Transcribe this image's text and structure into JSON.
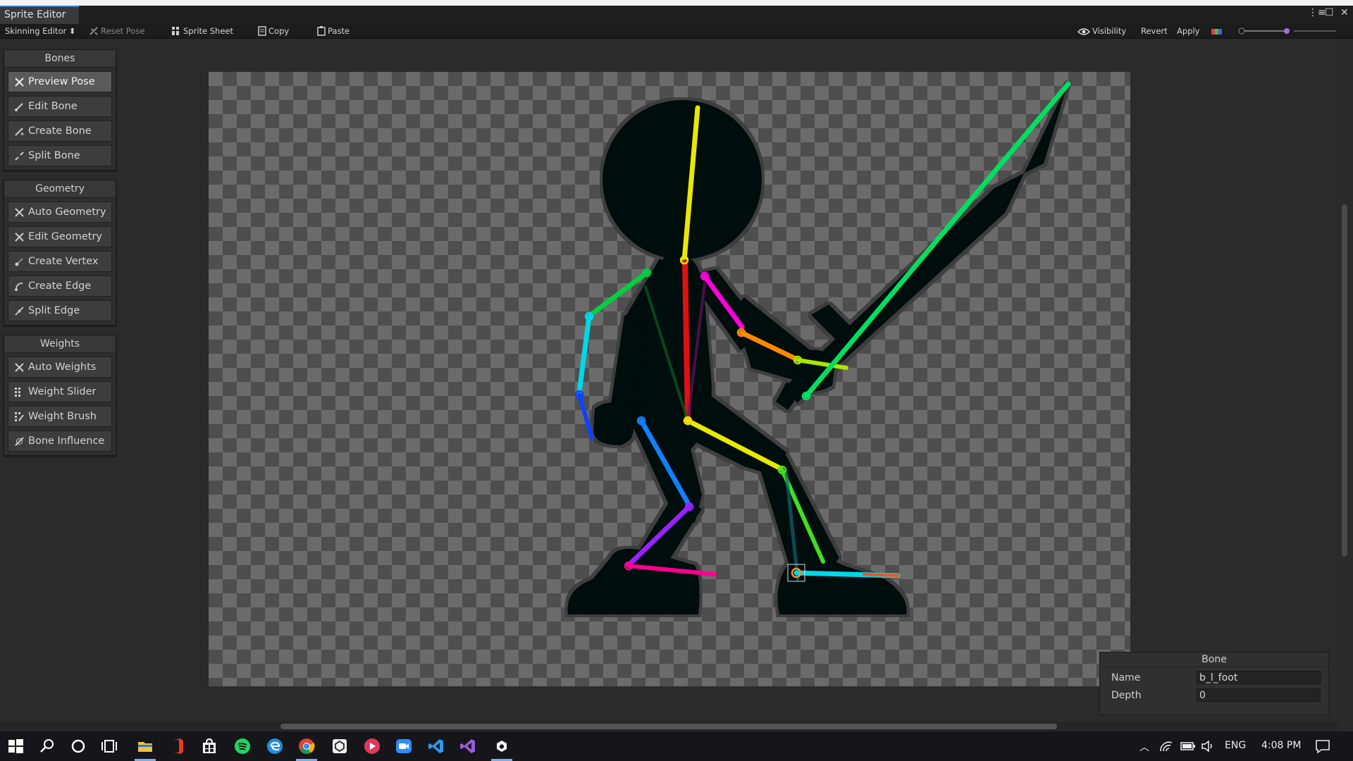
{
  "window": {
    "tab_title": "Sprite Editor"
  },
  "toolbar": {
    "mode_dropdown": "Skinning Editor",
    "reset_pose": "Reset Pose",
    "sprite_sheet": "Sprite Sheet",
    "copy": "Copy",
    "paste": "Paste",
    "visibility": "Visibility",
    "revert": "Revert",
    "apply": "Apply"
  },
  "panels": {
    "bones": {
      "title": "Bones",
      "items": [
        "Preview Pose",
        "Edit Bone",
        "Create Bone",
        "Split Bone"
      ],
      "active": "Preview Pose"
    },
    "geometry": {
      "title": "Geometry",
      "items": [
        "Auto Geometry",
        "Edit Geometry",
        "Create Vertex",
        "Create Edge",
        "Split Edge"
      ]
    },
    "weights": {
      "title": "Weights",
      "items": [
        "Auto Weights",
        "Weight Slider",
        "Weight Brush",
        "Bone Influence"
      ]
    }
  },
  "bone_inspector": {
    "title": "Bone",
    "name_label": "Name",
    "name_value": "b_l_foot",
    "depth_label": "Depth",
    "depth_value": "0"
  },
  "taskbar": {
    "language": "ENG",
    "time": "4:08 PM",
    "apps": [
      "start-icon",
      "search-icon",
      "cortana-icon",
      "task-view-icon",
      "file-explorer-icon",
      "office-icon",
      "store-icon",
      "spotify-icon",
      "edge-icon",
      "chrome-icon",
      "unity-hub-icon",
      "cast-app-icon",
      "zoom-icon",
      "vscode-icon",
      "visual-studio-icon",
      "unity-icon"
    ]
  },
  "colors": {
    "accent": "#3c78c8",
    "bone_yellow": "#e8e800",
    "bone_red": "#e01010",
    "bone_green": "#00e060",
    "bone_cyan": "#00d8e8",
    "bone_magenta": "#ff00cc",
    "bone_orange": "#ff8800",
    "bone_blue": "#1060ff",
    "bone_purple": "#9a20ff"
  }
}
